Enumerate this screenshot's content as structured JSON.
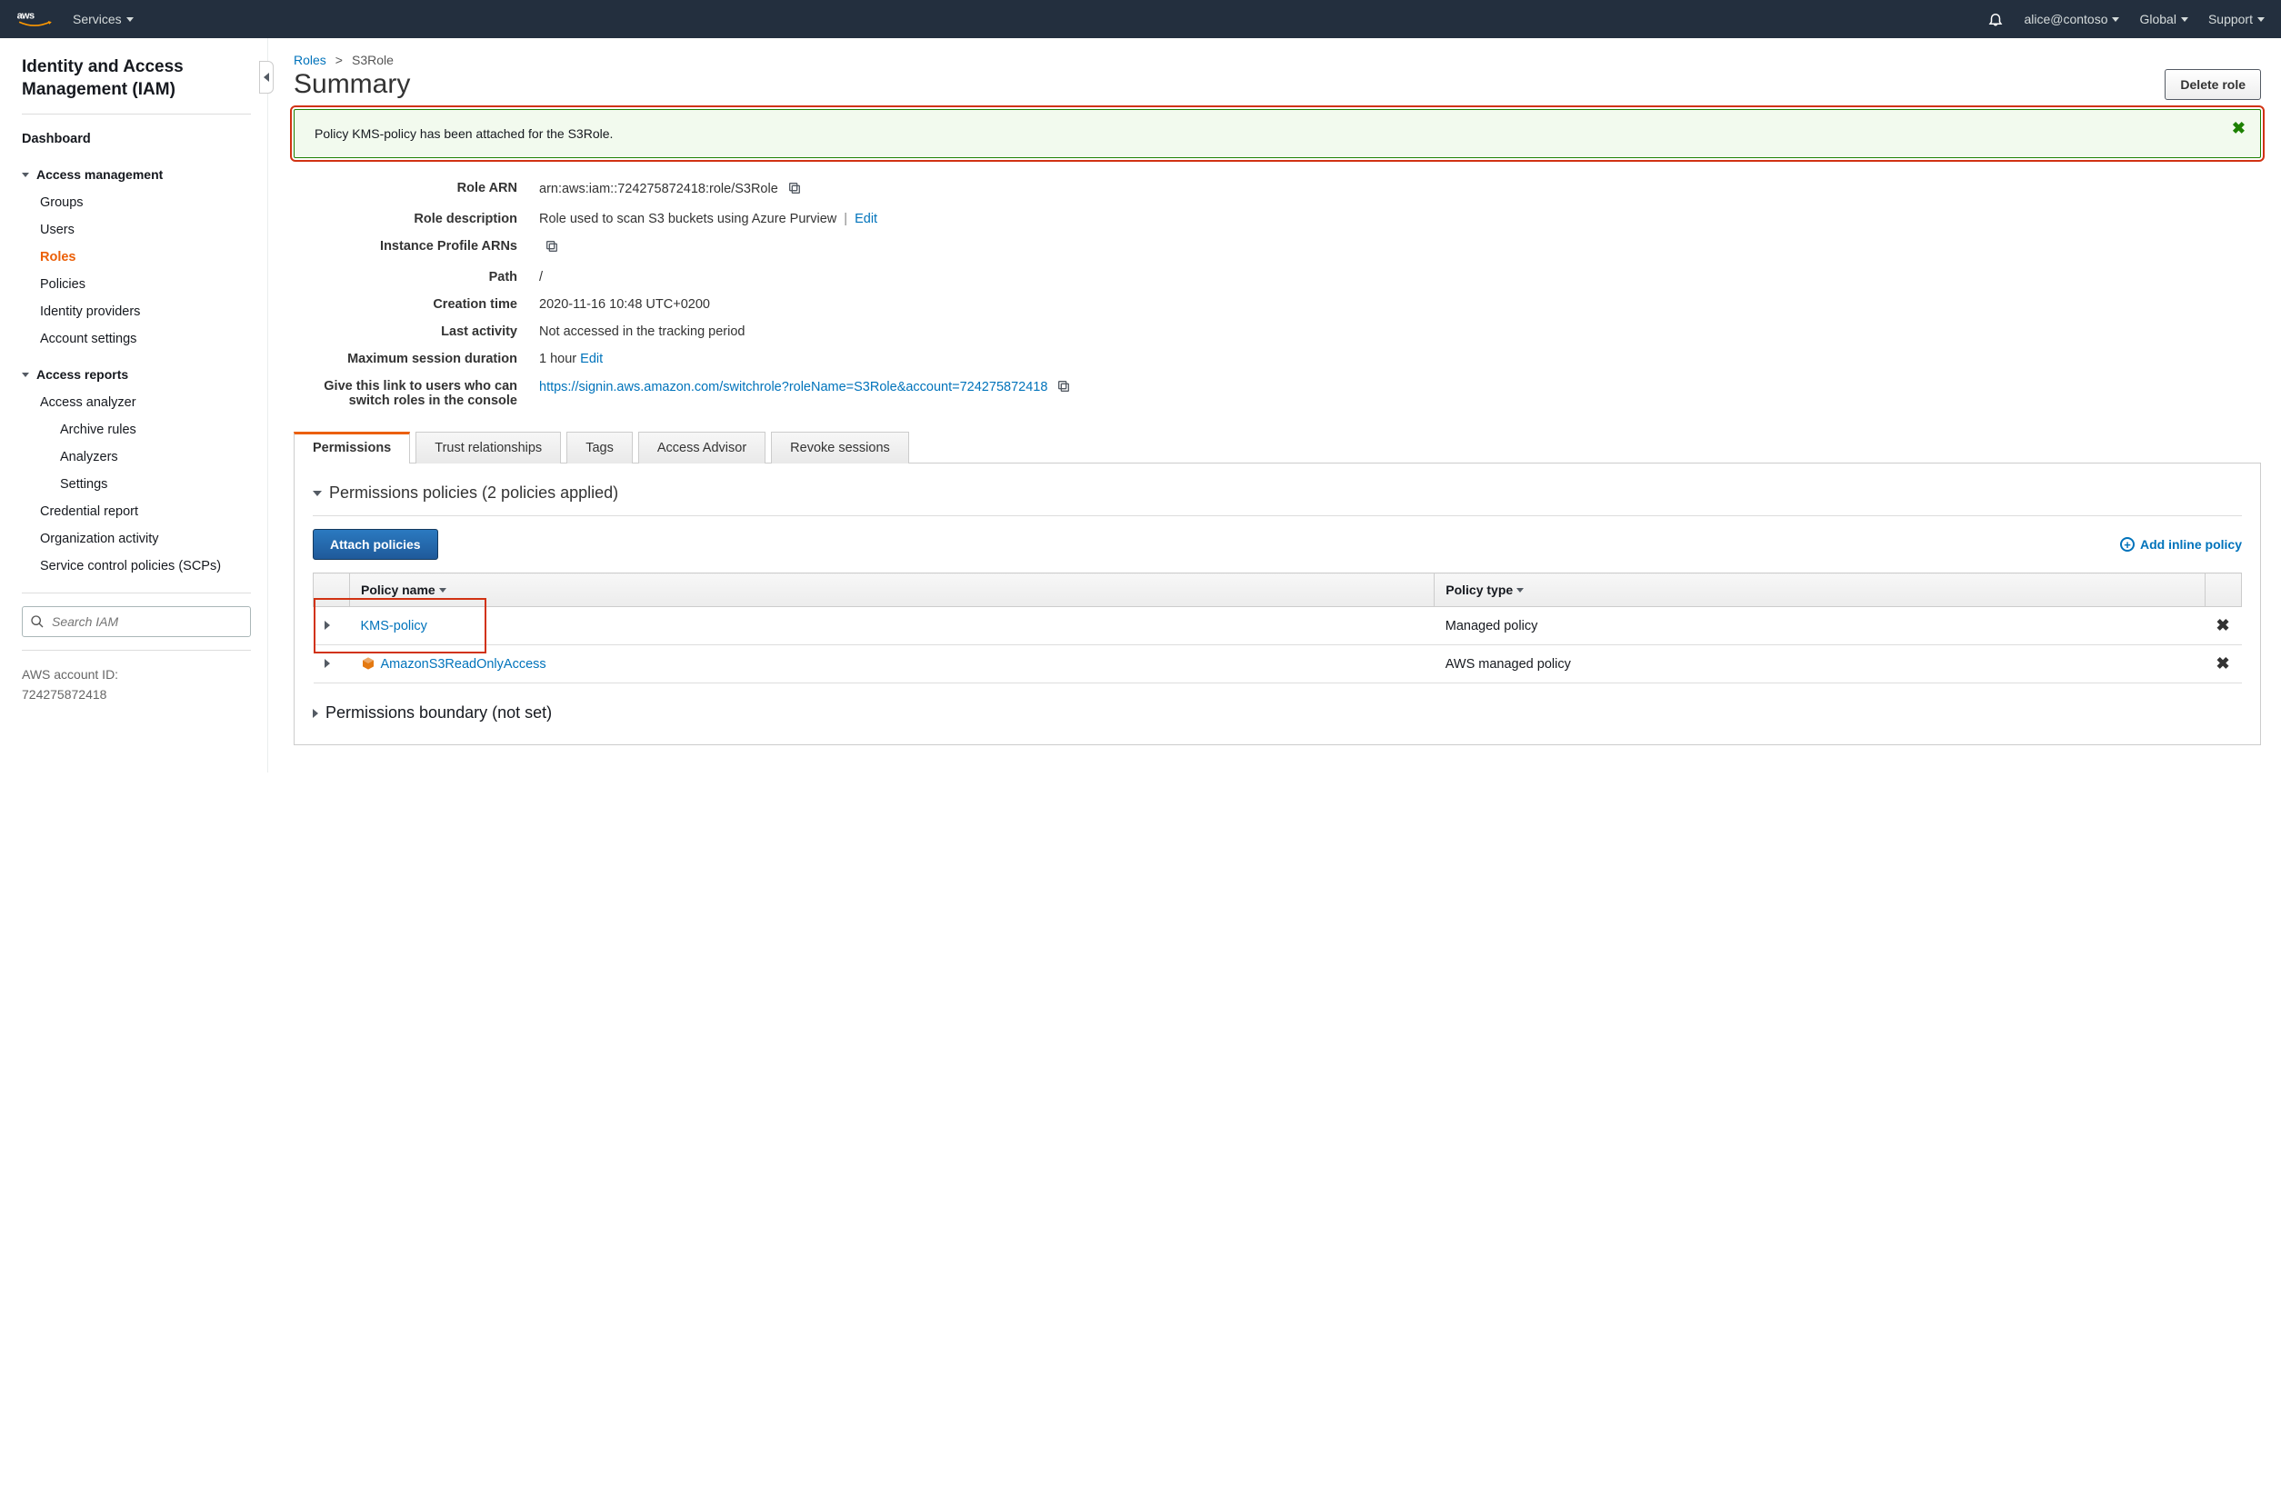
{
  "topnav": {
    "services": "Services",
    "user": "alice@contoso",
    "region": "Global",
    "support": "Support"
  },
  "sidebar": {
    "title": "Identity and Access Management (IAM)",
    "dashboard": "Dashboard",
    "s1": "Access management",
    "i_groups": "Groups",
    "i_users": "Users",
    "i_roles": "Roles",
    "i_policies": "Policies",
    "i_idp": "Identity providers",
    "i_acct": "Account settings",
    "s2": "Access reports",
    "i_analyzer": "Access analyzer",
    "i_archive": "Archive rules",
    "i_analyzers": "Analyzers",
    "i_settings": "Settings",
    "i_cred": "Credential report",
    "i_org": "Organization activity",
    "i_scp": "Service control policies (SCPs)",
    "search_ph": "Search IAM",
    "acct_label": "AWS account ID:",
    "acct_id": "724275872418"
  },
  "crumbs": {
    "roles": "Roles",
    "sep": ">",
    "current": "S3Role"
  },
  "title": "Summary",
  "delete_btn": "Delete role",
  "alert": {
    "msg": "Policy KMS-policy has been attached for the S3Role."
  },
  "props": {
    "l_arn": "Role ARN",
    "v_arn": "arn:aws:iam::724275872418:role/S3Role",
    "l_desc": "Role description",
    "v_desc": "Role used to scan S3 buckets using Azure Purview",
    "edit": "Edit",
    "l_ip": "Instance Profile ARNs",
    "l_path": "Path",
    "v_path": "/",
    "l_ct": "Creation time",
    "v_ct": "2020-11-16 10:48 UTC+0200",
    "l_la": "Last activity",
    "v_la": "Not accessed in the tracking period",
    "l_ms": "Maximum session duration",
    "v_ms": "1 hour",
    "l_link1": "Give this link to users who can",
    "l_link2": "switch roles in the console",
    "v_link": "https://signin.aws.amazon.com/switchrole?roleName=S3Role&account=724275872418"
  },
  "tabs": {
    "perm": "Permissions",
    "trust": "Trust relationships",
    "tags": "Tags",
    "advisor": "Access Advisor",
    "revoke": "Revoke sessions"
  },
  "perm_panel": {
    "section": "Permissions policies (2 policies applied)",
    "attach_btn": "Attach policies",
    "add_inline": "Add inline policy",
    "col_name": "Policy name",
    "col_type": "Policy type",
    "rows": [
      {
        "name": "KMS-policy",
        "type": "Managed policy",
        "icon": "none",
        "hl": true
      },
      {
        "name": "AmazonS3ReadOnlyAccess",
        "type": "AWS managed policy",
        "icon": "cube",
        "hl": false
      }
    ],
    "boundary": "Permissions boundary (not set)"
  }
}
